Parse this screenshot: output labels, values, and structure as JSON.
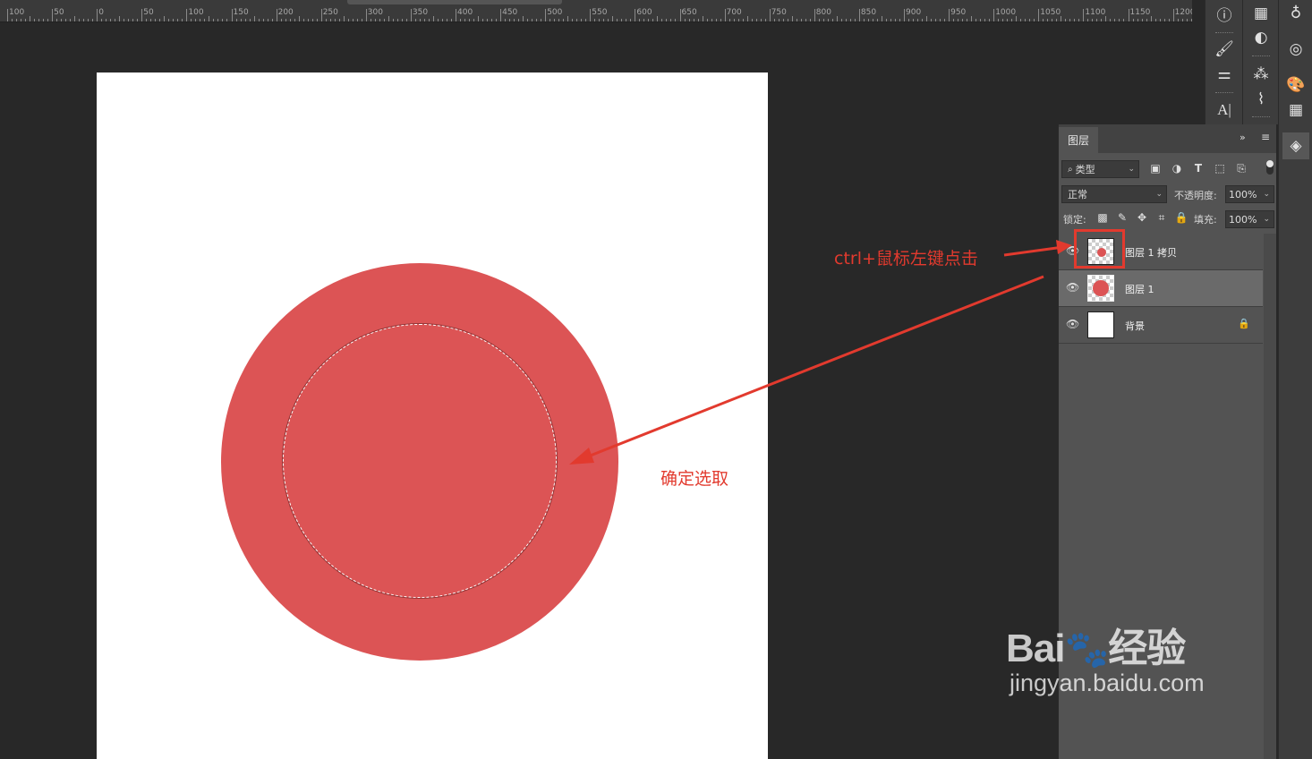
{
  "ruler": {
    "labels": [
      "100",
      "50",
      "0",
      "50",
      "100",
      "150",
      "200",
      "250",
      "300",
      "350",
      "400",
      "450",
      "500",
      "550",
      "600",
      "650",
      "700",
      "750",
      "800",
      "850",
      "900",
      "950",
      "1000",
      "1050",
      "1100",
      "1150",
      "1200"
    ]
  },
  "layers_panel": {
    "tab_label": "图层",
    "filter_label": "类型",
    "blend_mode": "正常",
    "opacity_label": "不透明度:",
    "opacity_value": "100%",
    "lock_label": "锁定:",
    "fill_label": "填充:",
    "fill_value": "100%",
    "layers": [
      {
        "name": "图层 1 拷贝",
        "selected": false,
        "thumb": "small-dot"
      },
      {
        "name": "图层 1",
        "selected": true,
        "thumb": "big-dot"
      },
      {
        "name": "背景",
        "selected": false,
        "thumb": "white",
        "locked": true
      }
    ]
  },
  "annotations": {
    "ctrl_click": "ctrl+鼠标左键点击",
    "confirm_selection": "确定选取"
  },
  "watermark": {
    "logo_text": "Bai",
    "logo_text2": "经验",
    "url": "jingyan.baidu.com"
  },
  "colors": {
    "circle_fill": "#dc5455",
    "annotation_red": "#e23a2e",
    "canvas_bg": "#ffffff",
    "workspace_bg": "#282828",
    "panel_bg": "#535353"
  }
}
